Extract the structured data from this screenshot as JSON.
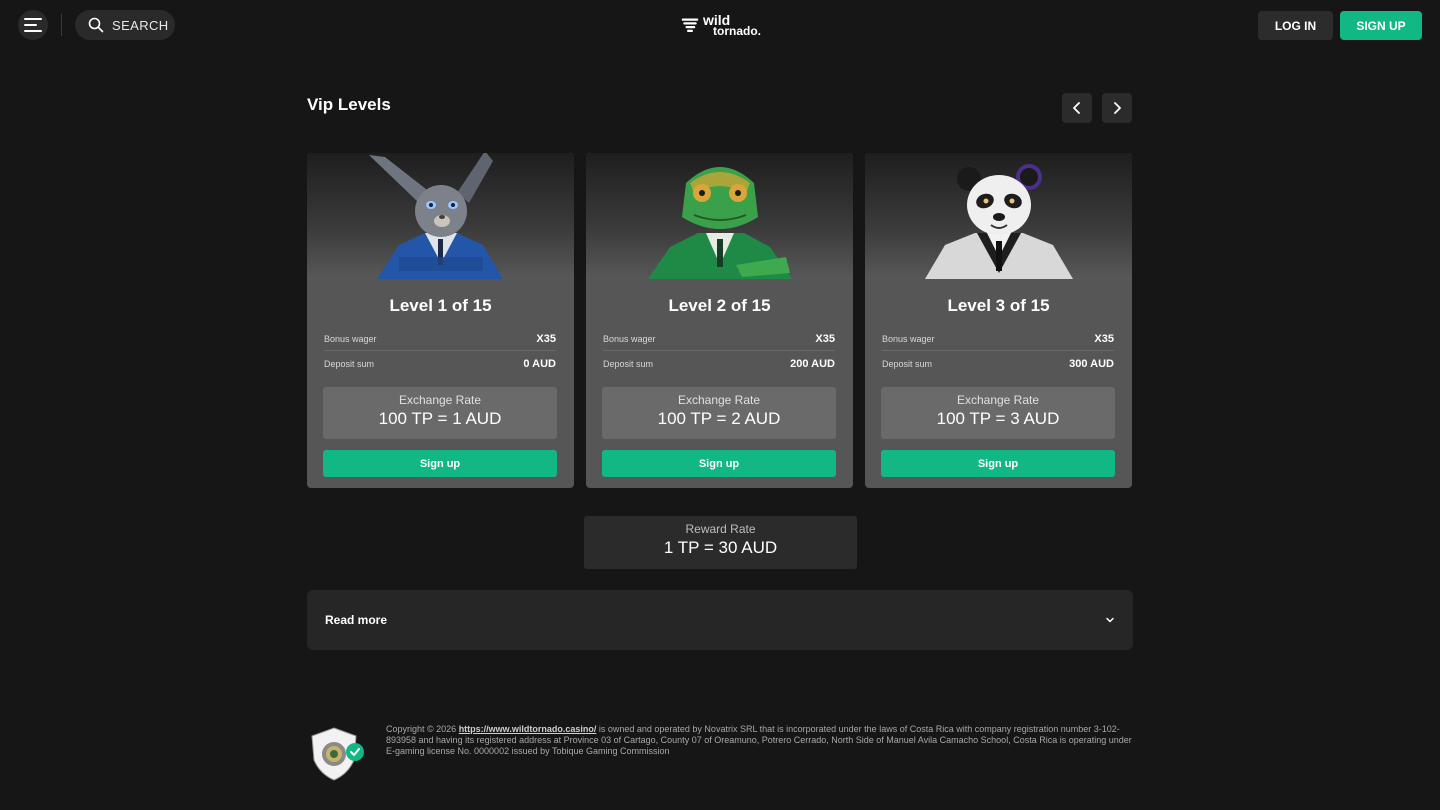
{
  "header": {
    "search_label": "SEARCH",
    "logo_line1": "wild",
    "logo_line2": "tornado.",
    "login_label": "LOG IN",
    "signup_label": "SIGN UP"
  },
  "section": {
    "title": "Vip Levels"
  },
  "cards": [
    {
      "title": "Level 1 of 15",
      "bonus_label": "Bonus wager",
      "bonus_value": "X35",
      "deposit_label": "Deposit sum",
      "deposit_value": "0 AUD",
      "rate_caption": "Exchange Rate",
      "rate_value": "100 TP = 1 AUD",
      "button_label": "Sign up",
      "image": "rabbit-in-blue-suit"
    },
    {
      "title": "Level 2 of 15",
      "bonus_label": "Bonus wager",
      "bonus_value": "X35",
      "deposit_label": "Deposit sum",
      "deposit_value": "200 AUD",
      "rate_caption": "Exchange Rate",
      "rate_value": "100 TP = 2 AUD",
      "button_label": "Sign up",
      "image": "chameleon-in-green-suit"
    },
    {
      "title": "Level 3 of 15",
      "bonus_label": "Bonus wager",
      "bonus_value": "X35",
      "deposit_label": "Deposit sum",
      "deposit_value": "300 AUD",
      "rate_caption": "Exchange Rate",
      "rate_value": "100 TP = 3 AUD",
      "button_label": "Sign up",
      "image": "panda-in-white-suit"
    }
  ],
  "reward": {
    "caption": "Reward Rate",
    "value": "1 TP = 30 AUD"
  },
  "read_more": {
    "label": "Read more"
  },
  "footer": {
    "text_before": "Copyright © 2026 ",
    "link": "https://www.wildtornado.casino/",
    "text_after": " is owned and operated by Novatrix SRL that is incorporated under the laws of Costa Rica with company registration number 3-102-893958 and having its registered address at Province 03 of Cartago, County 07 of Oreamuno, Potrero Cerrado, North Side of Manuel Avila Camacho School, Costa Rica is operating under E-gaming license No. 0000002 issued by Tobique Gaming Commission"
  },
  "colors": {
    "accent": "#11b886",
    "background": "#161616",
    "card": "#565656"
  }
}
